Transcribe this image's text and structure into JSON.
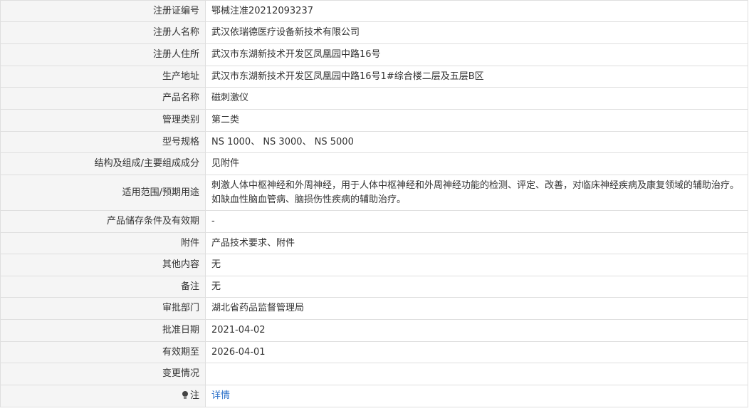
{
  "rows": [
    {
      "label": "注册证编号",
      "value": "鄂械注准20212093237"
    },
    {
      "label": "注册人名称",
      "value": "武汉依瑞德医疗设备新技术有限公司"
    },
    {
      "label": "注册人住所",
      "value": "武汉市东湖新技术开发区凤凰园中路16号"
    },
    {
      "label": "生产地址",
      "value": "武汉市东湖新技术开发区凤凰园中路16号1#综合楼二层及五层B区"
    },
    {
      "label": "产品名称",
      "value": "磁刺激仪"
    },
    {
      "label": "管理类别",
      "value": "第二类"
    },
    {
      "label": "型号规格",
      "value": "NS 1000、 NS 3000、 NS 5000"
    },
    {
      "label": "结构及组成/主要组成成分",
      "value": "见附件"
    },
    {
      "label": "适用范围/预期用途",
      "value": "刺激人体中枢神经和外周神经，用于人体中枢神经和外周神经功能的检测、评定、改善，对临床神经疾病及康复领域的辅助治疗。如缺血性脑血管病、脑损伤性疾病的辅助治疗。"
    },
    {
      "label": "产品储存条件及有效期",
      "value": "-"
    },
    {
      "label": "附件",
      "value": "产品技术要求、附件"
    },
    {
      "label": "其他内容",
      "value": "无"
    },
    {
      "label": "备注",
      "value": "无"
    },
    {
      "label": "审批部门",
      "value": "湖北省药品监督管理局"
    },
    {
      "label": "批准日期",
      "value": "2021-04-02"
    },
    {
      "label": "有效期至",
      "value": "2026-04-01"
    },
    {
      "label": "变更情况",
      "value": ""
    },
    {
      "label": "注",
      "value": "详情",
      "icon": "lightbulb-icon"
    }
  ],
  "colors": {
    "label_bg": "#f5f5f5",
    "border": "#dfdfdf",
    "text": "#333333",
    "link": "#2a6fc9"
  }
}
